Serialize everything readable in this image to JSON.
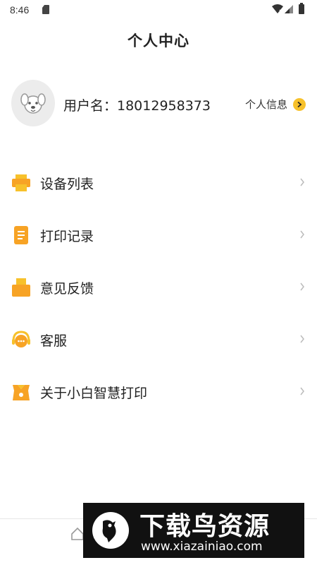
{
  "status_bar": {
    "time": "8:46"
  },
  "header": {
    "title": "个人中心"
  },
  "profile": {
    "username_label": "用户名：18012958373",
    "info_link": "个人信息"
  },
  "menu": [
    {
      "label": "设备列表",
      "icon": "printer-icon"
    },
    {
      "label": "打印记录",
      "icon": "document-icon"
    },
    {
      "label": "意见反馈",
      "icon": "feedback-box-icon"
    },
    {
      "label": "客服",
      "icon": "headset-icon"
    },
    {
      "label": "关于小白智慧打印",
      "icon": "about-badge-icon"
    }
  ],
  "colors": {
    "accent_orange": "#f7a325",
    "accent_yellow": "#f7c12b"
  },
  "watermark": {
    "title": "下载鸟资源",
    "url": "www.xiazainiao.com"
  }
}
